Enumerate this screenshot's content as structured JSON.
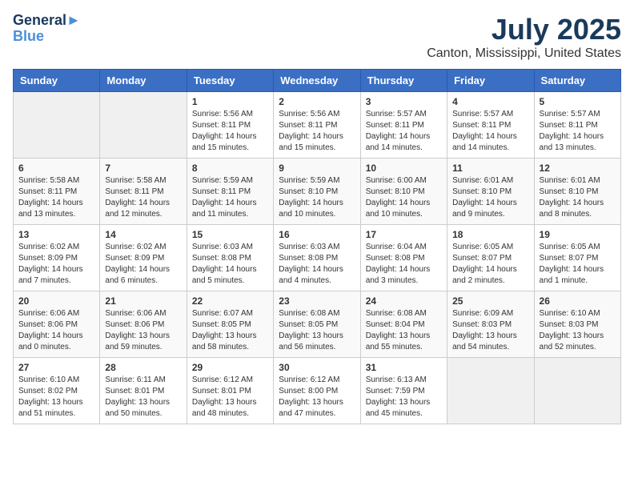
{
  "header": {
    "logo_line1": "General",
    "logo_line2": "Blue",
    "month": "July 2025",
    "location": "Canton, Mississippi, United States"
  },
  "weekdays": [
    "Sunday",
    "Monday",
    "Tuesday",
    "Wednesday",
    "Thursday",
    "Friday",
    "Saturday"
  ],
  "weeks": [
    [
      {
        "day": "",
        "info": ""
      },
      {
        "day": "",
        "info": ""
      },
      {
        "day": "1",
        "info": "Sunrise: 5:56 AM\nSunset: 8:11 PM\nDaylight: 14 hours and 15 minutes."
      },
      {
        "day": "2",
        "info": "Sunrise: 5:56 AM\nSunset: 8:11 PM\nDaylight: 14 hours and 15 minutes."
      },
      {
        "day": "3",
        "info": "Sunrise: 5:57 AM\nSunset: 8:11 PM\nDaylight: 14 hours and 14 minutes."
      },
      {
        "day": "4",
        "info": "Sunrise: 5:57 AM\nSunset: 8:11 PM\nDaylight: 14 hours and 14 minutes."
      },
      {
        "day": "5",
        "info": "Sunrise: 5:57 AM\nSunset: 8:11 PM\nDaylight: 14 hours and 13 minutes."
      }
    ],
    [
      {
        "day": "6",
        "info": "Sunrise: 5:58 AM\nSunset: 8:11 PM\nDaylight: 14 hours and 13 minutes."
      },
      {
        "day": "7",
        "info": "Sunrise: 5:58 AM\nSunset: 8:11 PM\nDaylight: 14 hours and 12 minutes."
      },
      {
        "day": "8",
        "info": "Sunrise: 5:59 AM\nSunset: 8:11 PM\nDaylight: 14 hours and 11 minutes."
      },
      {
        "day": "9",
        "info": "Sunrise: 5:59 AM\nSunset: 8:10 PM\nDaylight: 14 hours and 10 minutes."
      },
      {
        "day": "10",
        "info": "Sunrise: 6:00 AM\nSunset: 8:10 PM\nDaylight: 14 hours and 10 minutes."
      },
      {
        "day": "11",
        "info": "Sunrise: 6:01 AM\nSunset: 8:10 PM\nDaylight: 14 hours and 9 minutes."
      },
      {
        "day": "12",
        "info": "Sunrise: 6:01 AM\nSunset: 8:10 PM\nDaylight: 14 hours and 8 minutes."
      }
    ],
    [
      {
        "day": "13",
        "info": "Sunrise: 6:02 AM\nSunset: 8:09 PM\nDaylight: 14 hours and 7 minutes."
      },
      {
        "day": "14",
        "info": "Sunrise: 6:02 AM\nSunset: 8:09 PM\nDaylight: 14 hours and 6 minutes."
      },
      {
        "day": "15",
        "info": "Sunrise: 6:03 AM\nSunset: 8:08 PM\nDaylight: 14 hours and 5 minutes."
      },
      {
        "day": "16",
        "info": "Sunrise: 6:03 AM\nSunset: 8:08 PM\nDaylight: 14 hours and 4 minutes."
      },
      {
        "day": "17",
        "info": "Sunrise: 6:04 AM\nSunset: 8:08 PM\nDaylight: 14 hours and 3 minutes."
      },
      {
        "day": "18",
        "info": "Sunrise: 6:05 AM\nSunset: 8:07 PM\nDaylight: 14 hours and 2 minutes."
      },
      {
        "day": "19",
        "info": "Sunrise: 6:05 AM\nSunset: 8:07 PM\nDaylight: 14 hours and 1 minute."
      }
    ],
    [
      {
        "day": "20",
        "info": "Sunrise: 6:06 AM\nSunset: 8:06 PM\nDaylight: 14 hours and 0 minutes."
      },
      {
        "day": "21",
        "info": "Sunrise: 6:06 AM\nSunset: 8:06 PM\nDaylight: 13 hours and 59 minutes."
      },
      {
        "day": "22",
        "info": "Sunrise: 6:07 AM\nSunset: 8:05 PM\nDaylight: 13 hours and 58 minutes."
      },
      {
        "day": "23",
        "info": "Sunrise: 6:08 AM\nSunset: 8:05 PM\nDaylight: 13 hours and 56 minutes."
      },
      {
        "day": "24",
        "info": "Sunrise: 6:08 AM\nSunset: 8:04 PM\nDaylight: 13 hours and 55 minutes."
      },
      {
        "day": "25",
        "info": "Sunrise: 6:09 AM\nSunset: 8:03 PM\nDaylight: 13 hours and 54 minutes."
      },
      {
        "day": "26",
        "info": "Sunrise: 6:10 AM\nSunset: 8:03 PM\nDaylight: 13 hours and 52 minutes."
      }
    ],
    [
      {
        "day": "27",
        "info": "Sunrise: 6:10 AM\nSunset: 8:02 PM\nDaylight: 13 hours and 51 minutes."
      },
      {
        "day": "28",
        "info": "Sunrise: 6:11 AM\nSunset: 8:01 PM\nDaylight: 13 hours and 50 minutes."
      },
      {
        "day": "29",
        "info": "Sunrise: 6:12 AM\nSunset: 8:01 PM\nDaylight: 13 hours and 48 minutes."
      },
      {
        "day": "30",
        "info": "Sunrise: 6:12 AM\nSunset: 8:00 PM\nDaylight: 13 hours and 47 minutes."
      },
      {
        "day": "31",
        "info": "Sunrise: 6:13 AM\nSunset: 7:59 PM\nDaylight: 13 hours and 45 minutes."
      },
      {
        "day": "",
        "info": ""
      },
      {
        "day": "",
        "info": ""
      }
    ]
  ]
}
